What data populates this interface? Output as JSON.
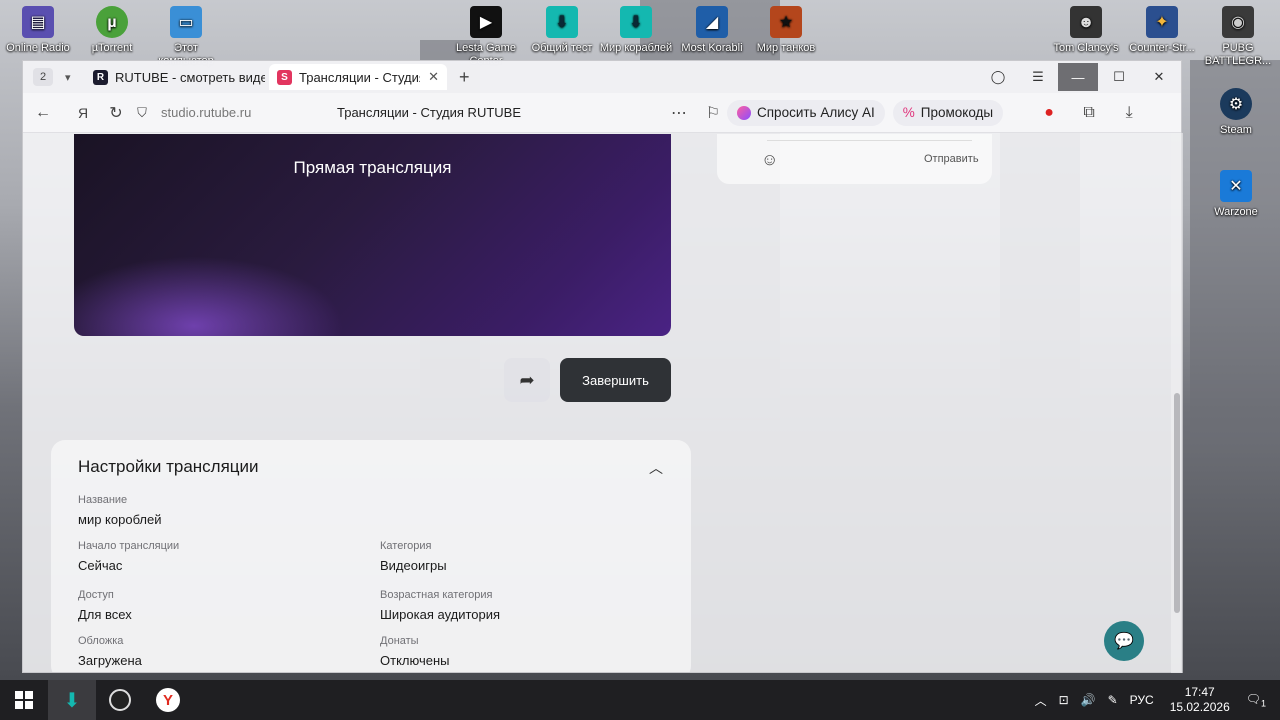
{
  "desktop": {
    "icons_top": [
      {
        "label": "Online Radio",
        "color": "#5a4fb0",
        "glyph": "▤"
      },
      {
        "label": "µTorrent",
        "color": "#4aa13a",
        "glyph": "µ"
      },
      {
        "label": "Этот компьютер",
        "color": "#3a8fd6",
        "glyph": "▭"
      },
      {
        "label": "Lesta Game Center",
        "color": "#111111",
        "glyph": "▶"
      },
      {
        "label": "Общий тест",
        "color": "#14b8b0",
        "glyph": "⬇"
      },
      {
        "label": "Мир кораблей",
        "color": "#14b8b0",
        "glyph": "⬇"
      },
      {
        "label": "Most Korabli",
        "color": "#1f5ea8",
        "glyph": "◢"
      },
      {
        "label": "Мир танков",
        "color": "#b4461c",
        "glyph": "★"
      },
      {
        "label": "Tom Clancy's",
        "color": "#333333",
        "glyph": "☻"
      },
      {
        "label": "Counter-Str...",
        "color": "#2b4f8f",
        "glyph": "✦"
      },
      {
        "label": "PUBG BATTLEGR...",
        "color": "#3a3a3a",
        "glyph": "◉"
      }
    ],
    "icons_right": [
      {
        "label": "Steam",
        "color": "#1b3a5c",
        "glyph": "⚙"
      },
      {
        "label": "Warzone",
        "color": "#1a7ad8",
        "glyph": "✕"
      }
    ]
  },
  "browser": {
    "tab_count": "2",
    "tabs": [
      {
        "title": "RUTUBE - смотреть виде",
        "fav": "R",
        "fav_color": "#1b1b2e"
      },
      {
        "title": "Трансляции - Студия R",
        "fav": "S",
        "fav_color": "#e2355f"
      }
    ],
    "url": "studio.rutube.ru",
    "page_title": "Трансляции - Студия RUTUBE",
    "alice_label": "Спросить Алису AI",
    "promo_label": "Промокоды"
  },
  "page": {
    "player_label": "Прямая трансляция",
    "finish_label": "Завершить",
    "chat_send_label": "Отправить",
    "settings": {
      "heading": "Настройки трансляции",
      "fields": [
        {
          "label": "Название",
          "value": "мир короблей"
        },
        {
          "label": "Начало трансляции",
          "value": "Сейчас"
        },
        {
          "label": "Категория",
          "value": "Видеоигры"
        },
        {
          "label": "Доступ",
          "value": "Для всех"
        },
        {
          "label": "Возрастная категория",
          "value": "Широкая аудитория"
        },
        {
          "label": "Обложка",
          "value": "Загружена"
        },
        {
          "label": "Донаты",
          "value": "Отключены"
        }
      ]
    }
  },
  "taskbar": {
    "lang": "РУС",
    "time": "17:47",
    "date": "15.02.2026",
    "notif_count": "1"
  }
}
